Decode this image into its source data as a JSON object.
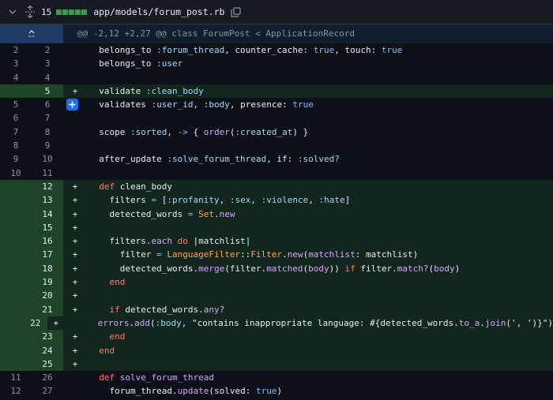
{
  "header": {
    "changed_count": "15",
    "file_path": "app/models/forum_post.rb",
    "diffstat_color": "#2ea043"
  },
  "hunk": {
    "text": "@@ -2,12 +2,27 @@ class ForumPost < ApplicationRecord",
    "expand_icon": "expand-up-icon"
  },
  "lines": [
    {
      "type": "ctx",
      "old": "2",
      "new": "2",
      "code": [
        [
          "  belongs_to ",
          ""
        ],
        [
          ":forum_thread",
          "sym"
        ],
        [
          ", counter_cache: ",
          ""
        ],
        [
          "true",
          "lit"
        ],
        [
          ", touch: ",
          ""
        ],
        [
          "true",
          "lit"
        ]
      ]
    },
    {
      "type": "ctx",
      "old": "3",
      "new": "3",
      "code": [
        [
          "  belongs_to ",
          ""
        ],
        [
          ":user",
          "sym"
        ]
      ]
    },
    {
      "type": "ctx",
      "old": "4",
      "new": "4",
      "code": []
    },
    {
      "type": "add",
      "old": "",
      "new": "5",
      "code": [
        [
          "  validate ",
          ""
        ],
        [
          ":clean_body",
          "sym"
        ]
      ]
    },
    {
      "type": "ctx",
      "old": "5",
      "new": "6",
      "plus_button": true,
      "code": [
        [
          "  validates ",
          ""
        ],
        [
          ":user_id",
          "sym"
        ],
        [
          ", ",
          ""
        ],
        [
          ":body",
          "sym"
        ],
        [
          ", presence: ",
          ""
        ],
        [
          "true",
          "lit"
        ]
      ]
    },
    {
      "type": "ctx",
      "old": "6",
      "new": "7",
      "code": []
    },
    {
      "type": "ctx",
      "old": "7",
      "new": "8",
      "code": [
        [
          "  scope ",
          ""
        ],
        [
          ":sorted",
          "sym"
        ],
        [
          ", ",
          ""
        ],
        [
          "->",
          "lit"
        ],
        [
          " { ",
          ""
        ],
        [
          "order",
          "mth"
        ],
        [
          "(",
          ""
        ],
        [
          ":created_at",
          "sym"
        ],
        [
          ") }",
          ""
        ]
      ]
    },
    {
      "type": "ctx",
      "old": "8",
      "new": "9",
      "code": []
    },
    {
      "type": "ctx",
      "old": "9",
      "new": "10",
      "code": [
        [
          "  after_update ",
          ""
        ],
        [
          ":solve_forum_thread",
          "sym"
        ],
        [
          ", if: ",
          ""
        ],
        [
          ":solved?",
          "sym"
        ]
      ]
    },
    {
      "type": "ctx",
      "old": "10",
      "new": "11",
      "code": []
    },
    {
      "type": "add",
      "old": "",
      "new": "12",
      "code": [
        [
          "  ",
          ""
        ],
        [
          "def",
          "kw"
        ],
        [
          " clean_body",
          ""
        ]
      ]
    },
    {
      "type": "add",
      "old": "",
      "new": "13",
      "code": [
        [
          "    filters ",
          ""
        ],
        [
          "=",
          "lit"
        ],
        [
          " [",
          ""
        ],
        [
          ":profanity",
          "sym"
        ],
        [
          ", ",
          ""
        ],
        [
          ":sex",
          "sym"
        ],
        [
          ", ",
          ""
        ],
        [
          ":violence",
          "sym"
        ],
        [
          ", ",
          ""
        ],
        [
          ":hate",
          "sym"
        ],
        [
          "]",
          ""
        ]
      ]
    },
    {
      "type": "add",
      "old": "",
      "new": "14",
      "code": [
        [
          "    detected_words ",
          ""
        ],
        [
          "=",
          "lit"
        ],
        [
          " ",
          ""
        ],
        [
          "Set",
          "const"
        ],
        [
          ".",
          ""
        ],
        [
          "new",
          "mth"
        ]
      ]
    },
    {
      "type": "add",
      "old": "",
      "new": "15",
      "code": []
    },
    {
      "type": "add",
      "old": "",
      "new": "16",
      "code": [
        [
          "    filters.",
          ""
        ],
        [
          "each",
          "mth"
        ],
        [
          " ",
          ""
        ],
        [
          "do",
          "kw"
        ],
        [
          " |matchlist|",
          ""
        ]
      ]
    },
    {
      "type": "add",
      "old": "",
      "new": "17",
      "code": [
        [
          "      filter ",
          ""
        ],
        [
          "=",
          "lit"
        ],
        [
          " ",
          ""
        ],
        [
          "LanguageFilter",
          "const"
        ],
        [
          "::",
          ""
        ],
        [
          "Filter",
          "const"
        ],
        [
          ".",
          ""
        ],
        [
          "new",
          "mth"
        ],
        [
          "(",
          ""
        ],
        [
          "matchlist",
          "mth"
        ],
        [
          ": matchlist)",
          ""
        ]
      ]
    },
    {
      "type": "add",
      "old": "",
      "new": "18",
      "code": [
        [
          "      detected_words.",
          ""
        ],
        [
          "merge",
          "mth"
        ],
        [
          "(filter.",
          ""
        ],
        [
          "matched",
          "mth"
        ],
        [
          "(",
          ""
        ],
        [
          "body",
          "mth"
        ],
        [
          ")) ",
          ""
        ],
        [
          "if",
          "kw"
        ],
        [
          " filter.",
          ""
        ],
        [
          "match?",
          "mth"
        ],
        [
          "(",
          ""
        ],
        [
          "body",
          "mth"
        ],
        [
          ")",
          ""
        ]
      ]
    },
    {
      "type": "add",
      "old": "",
      "new": "19",
      "code": [
        [
          "    ",
          ""
        ],
        [
          "end",
          "kw"
        ]
      ]
    },
    {
      "type": "add",
      "old": "",
      "new": "20",
      "code": []
    },
    {
      "type": "add",
      "old": "",
      "new": "21",
      "code": [
        [
          "    ",
          ""
        ],
        [
          "if",
          "kw"
        ],
        [
          " detected_words.",
          ""
        ],
        [
          "any?",
          "mth"
        ]
      ]
    },
    {
      "type": "add",
      "old": "",
      "new": "22",
      "code": [
        [
          "      ",
          ""
        ],
        [
          "errors",
          "mth"
        ],
        [
          ".",
          ""
        ],
        [
          "add",
          "mth"
        ],
        [
          "(",
          ""
        ],
        [
          ":body",
          "sym"
        ],
        [
          ", ",
          ""
        ],
        [
          "\"contains inappropriate language: #{detected_words.",
          ""
        ],
        [
          "to_a",
          "mth"
        ],
        [
          ".",
          ""
        ],
        [
          "join",
          "mth"
        ],
        [
          "(', ')}\")",
          ""
        ]
      ]
    },
    {
      "type": "add",
      "old": "",
      "new": "23",
      "code": [
        [
          "    ",
          ""
        ],
        [
          "end",
          "kw"
        ]
      ]
    },
    {
      "type": "add",
      "old": "",
      "new": "24",
      "code": [
        [
          "  ",
          ""
        ],
        [
          "end",
          "kw"
        ]
      ]
    },
    {
      "type": "add",
      "old": "",
      "new": "25",
      "code": []
    },
    {
      "type": "ctx",
      "old": "11",
      "new": "26",
      "code": [
        [
          "  ",
          ""
        ],
        [
          "def",
          "kw"
        ],
        [
          " ",
          ""
        ],
        [
          "solve_forum_thread",
          "mth"
        ]
      ]
    },
    {
      "type": "ctx",
      "old": "12",
      "new": "27",
      "code": [
        [
          "    forum_thread.",
          ""
        ],
        [
          "update",
          "mth"
        ],
        [
          "(solved: ",
          ""
        ],
        [
          "true",
          "lit"
        ],
        [
          ")",
          ""
        ]
      ]
    }
  ]
}
